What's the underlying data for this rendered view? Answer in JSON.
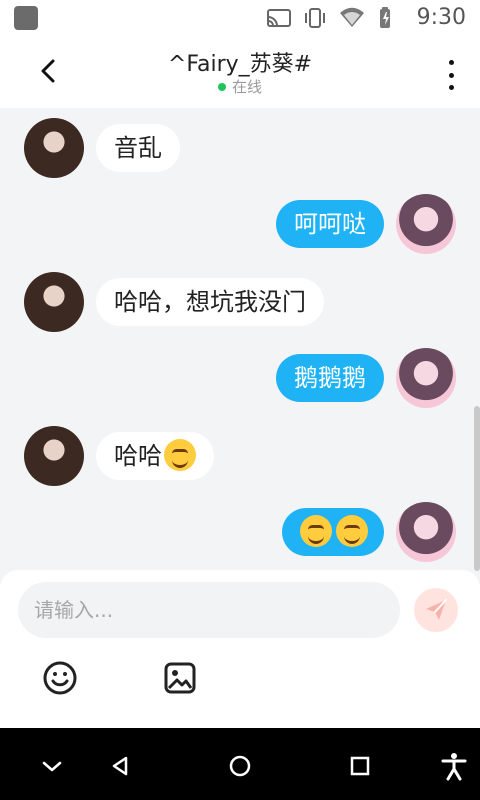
{
  "status": {
    "time": "9:30",
    "icons": [
      "cast-icon",
      "vibrate-icon",
      "wifi-icon",
      "battery-charging-icon"
    ]
  },
  "header": {
    "title": "^Fairy_苏葵#",
    "subtitle": "在线"
  },
  "messages": [
    {
      "side": "left",
      "text": "音乱"
    },
    {
      "side": "right",
      "text": "呵呵哒"
    },
    {
      "side": "left",
      "text": "哈哈，想坑我没门"
    },
    {
      "side": "right",
      "text": "鹅鹅鹅"
    },
    {
      "side": "left",
      "text": "哈哈"
    },
    {
      "side": "right",
      "text": ""
    }
  ],
  "composer": {
    "placeholder": "请输入..."
  },
  "colors": {
    "accent": "#1fb3f6",
    "bubble_left": "#ffffff",
    "online": "#21c35b"
  }
}
